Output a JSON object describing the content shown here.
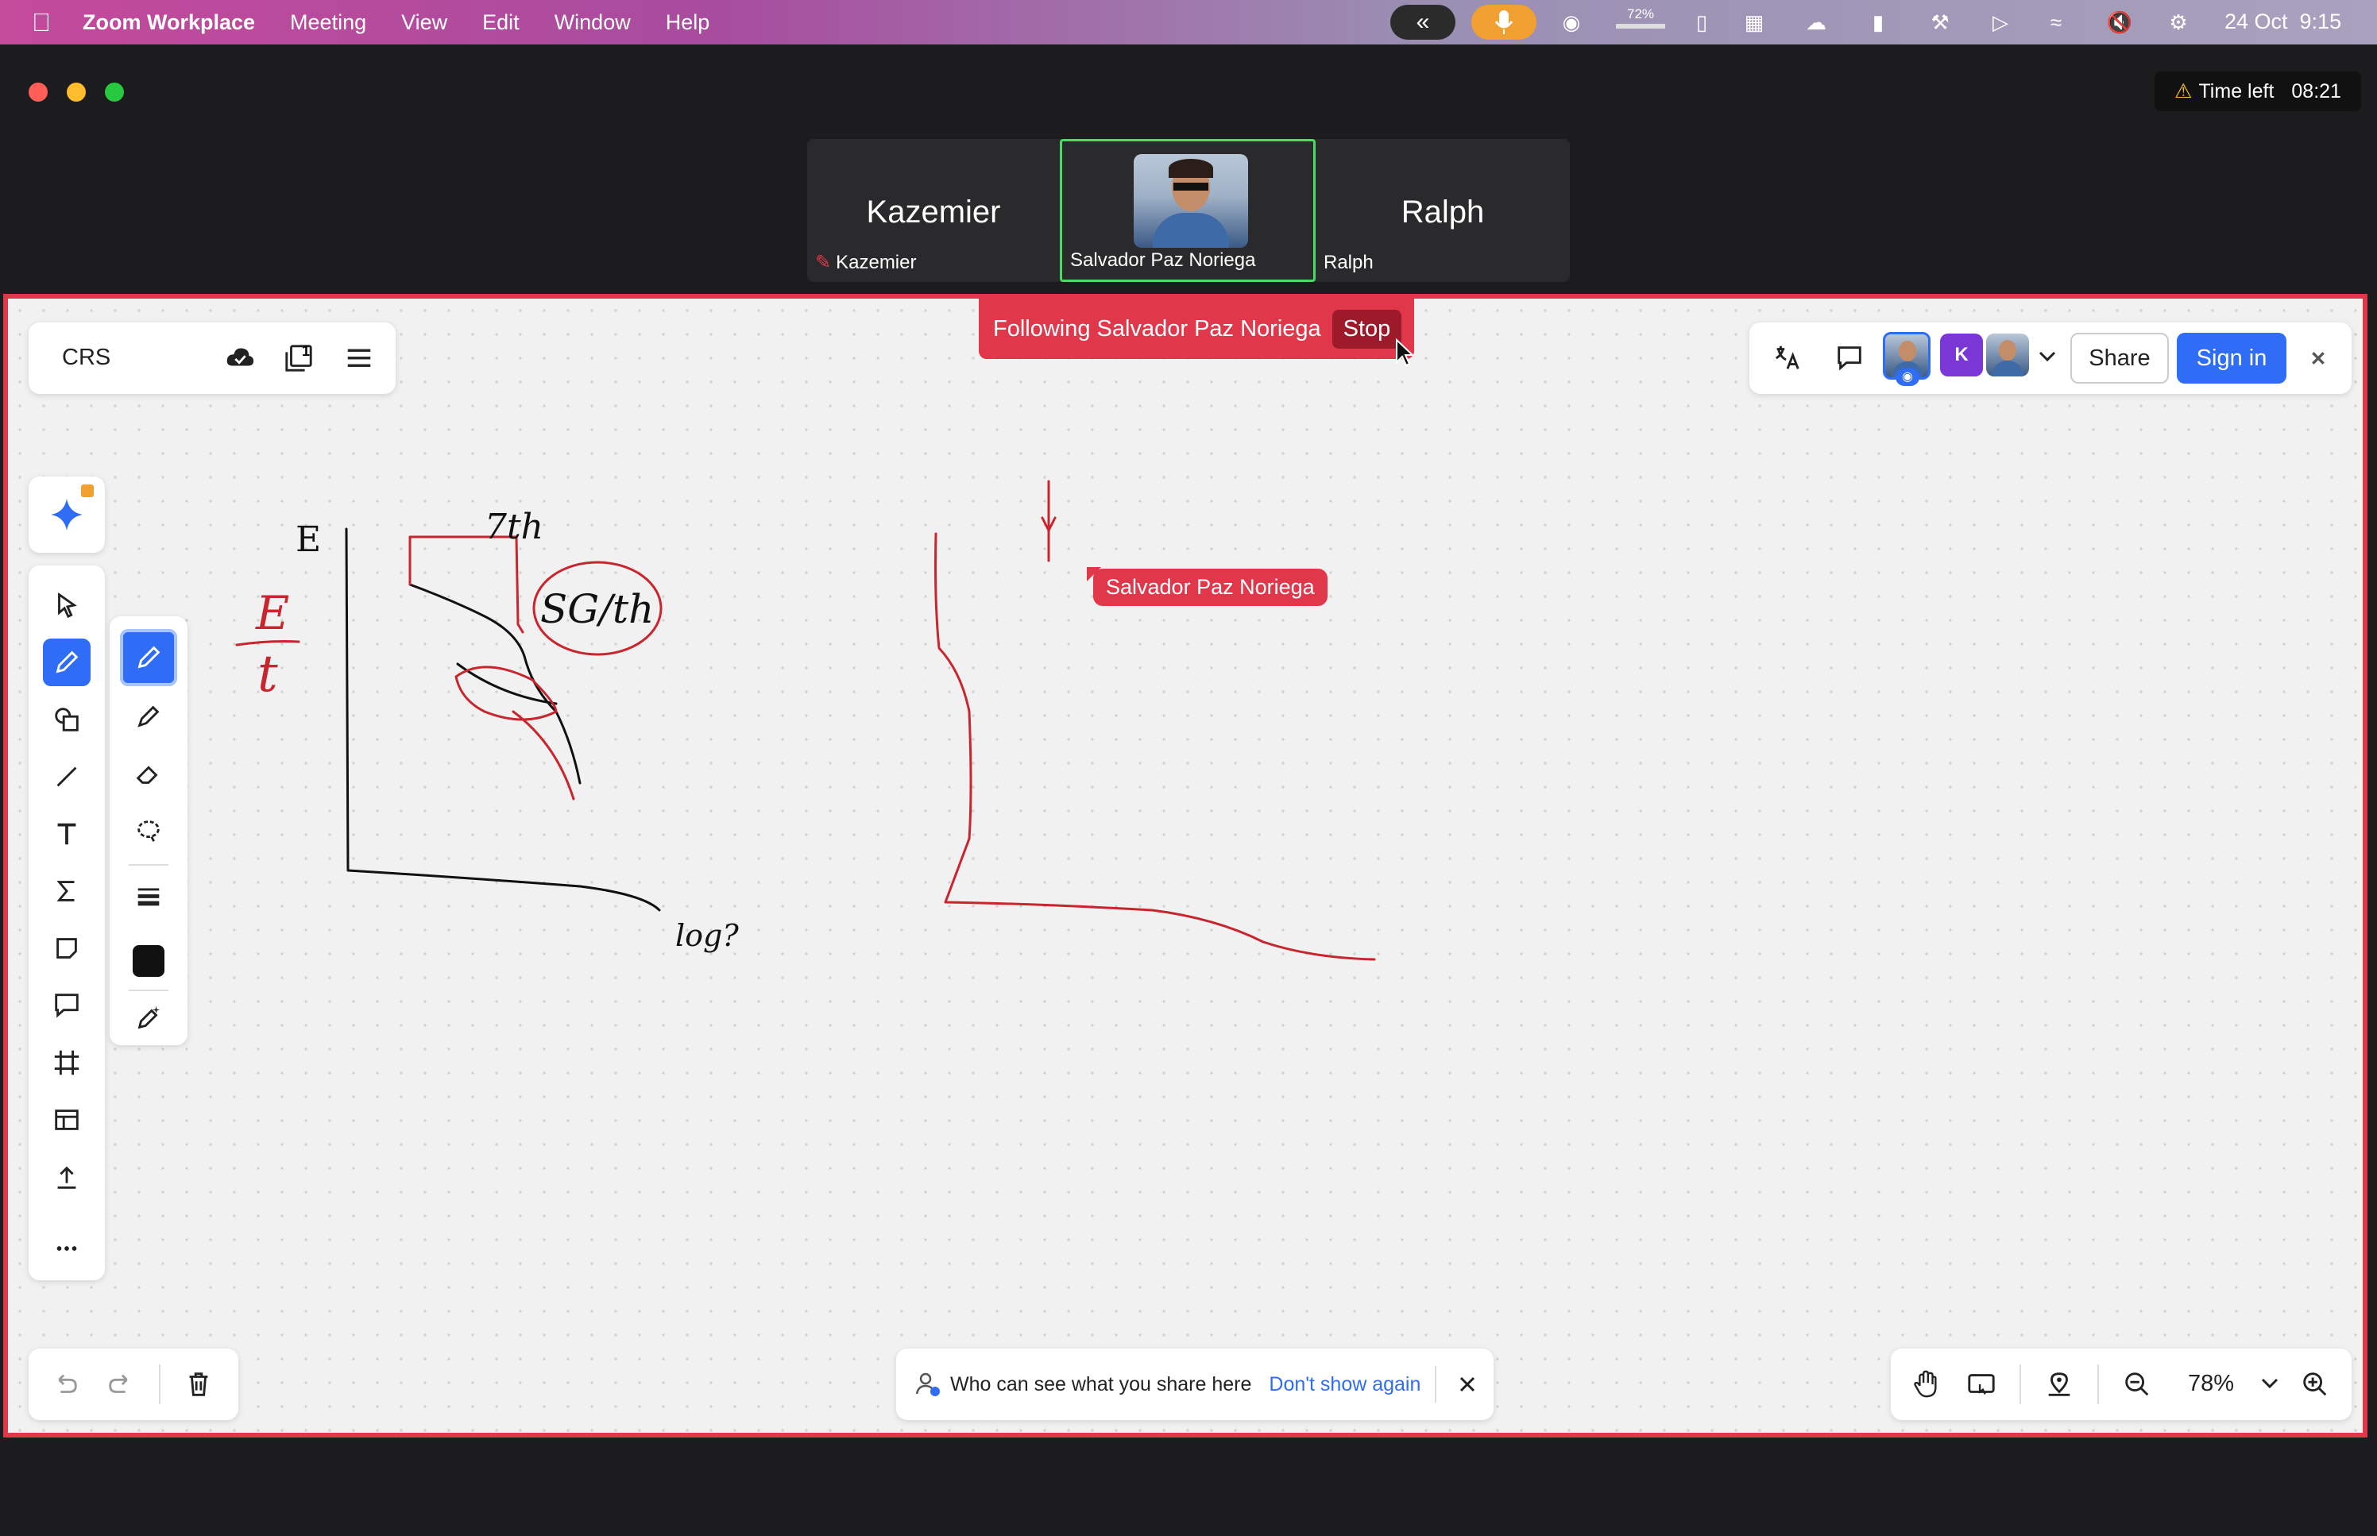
{
  "menubar": {
    "app_name": "Zoom Workplace",
    "items": [
      "Meeting",
      "View",
      "Edit",
      "Window",
      "Help"
    ],
    "battery_pct": "72%",
    "datetime": "24 Oct  9:15"
  },
  "window": {
    "time_left_label": "Time left",
    "time_left_value": "08:21"
  },
  "participants": [
    {
      "name_big": "Kazemier",
      "label": "Kazemier",
      "muted": true
    },
    {
      "name_big": "",
      "label": "Salvador Paz Noriega",
      "active": true
    },
    {
      "name_big": "Ralph",
      "label": "Ralph"
    }
  ],
  "whiteboard": {
    "title": "CRS",
    "page_count": "1",
    "follow_text": "Following Salvador Paz Noriega",
    "stop_label": "Stop",
    "share_label": "Share",
    "signin_label": "Sign in",
    "avatar_k": "K",
    "cursor_label": "Salvador Paz Noriega",
    "notice_text": "Who can see what you share here",
    "notice_link": "Don't show again",
    "zoom_level": "78%",
    "accent_color": "#2f6df6",
    "border_color": "#e1374a",
    "handwriting": {
      "axis_label_e": "E",
      "fraction_top": "E",
      "fraction_bottom": "t",
      "top_note": "7th",
      "bubble_note": "SG/th",
      "bottom_note": "log?"
    }
  }
}
